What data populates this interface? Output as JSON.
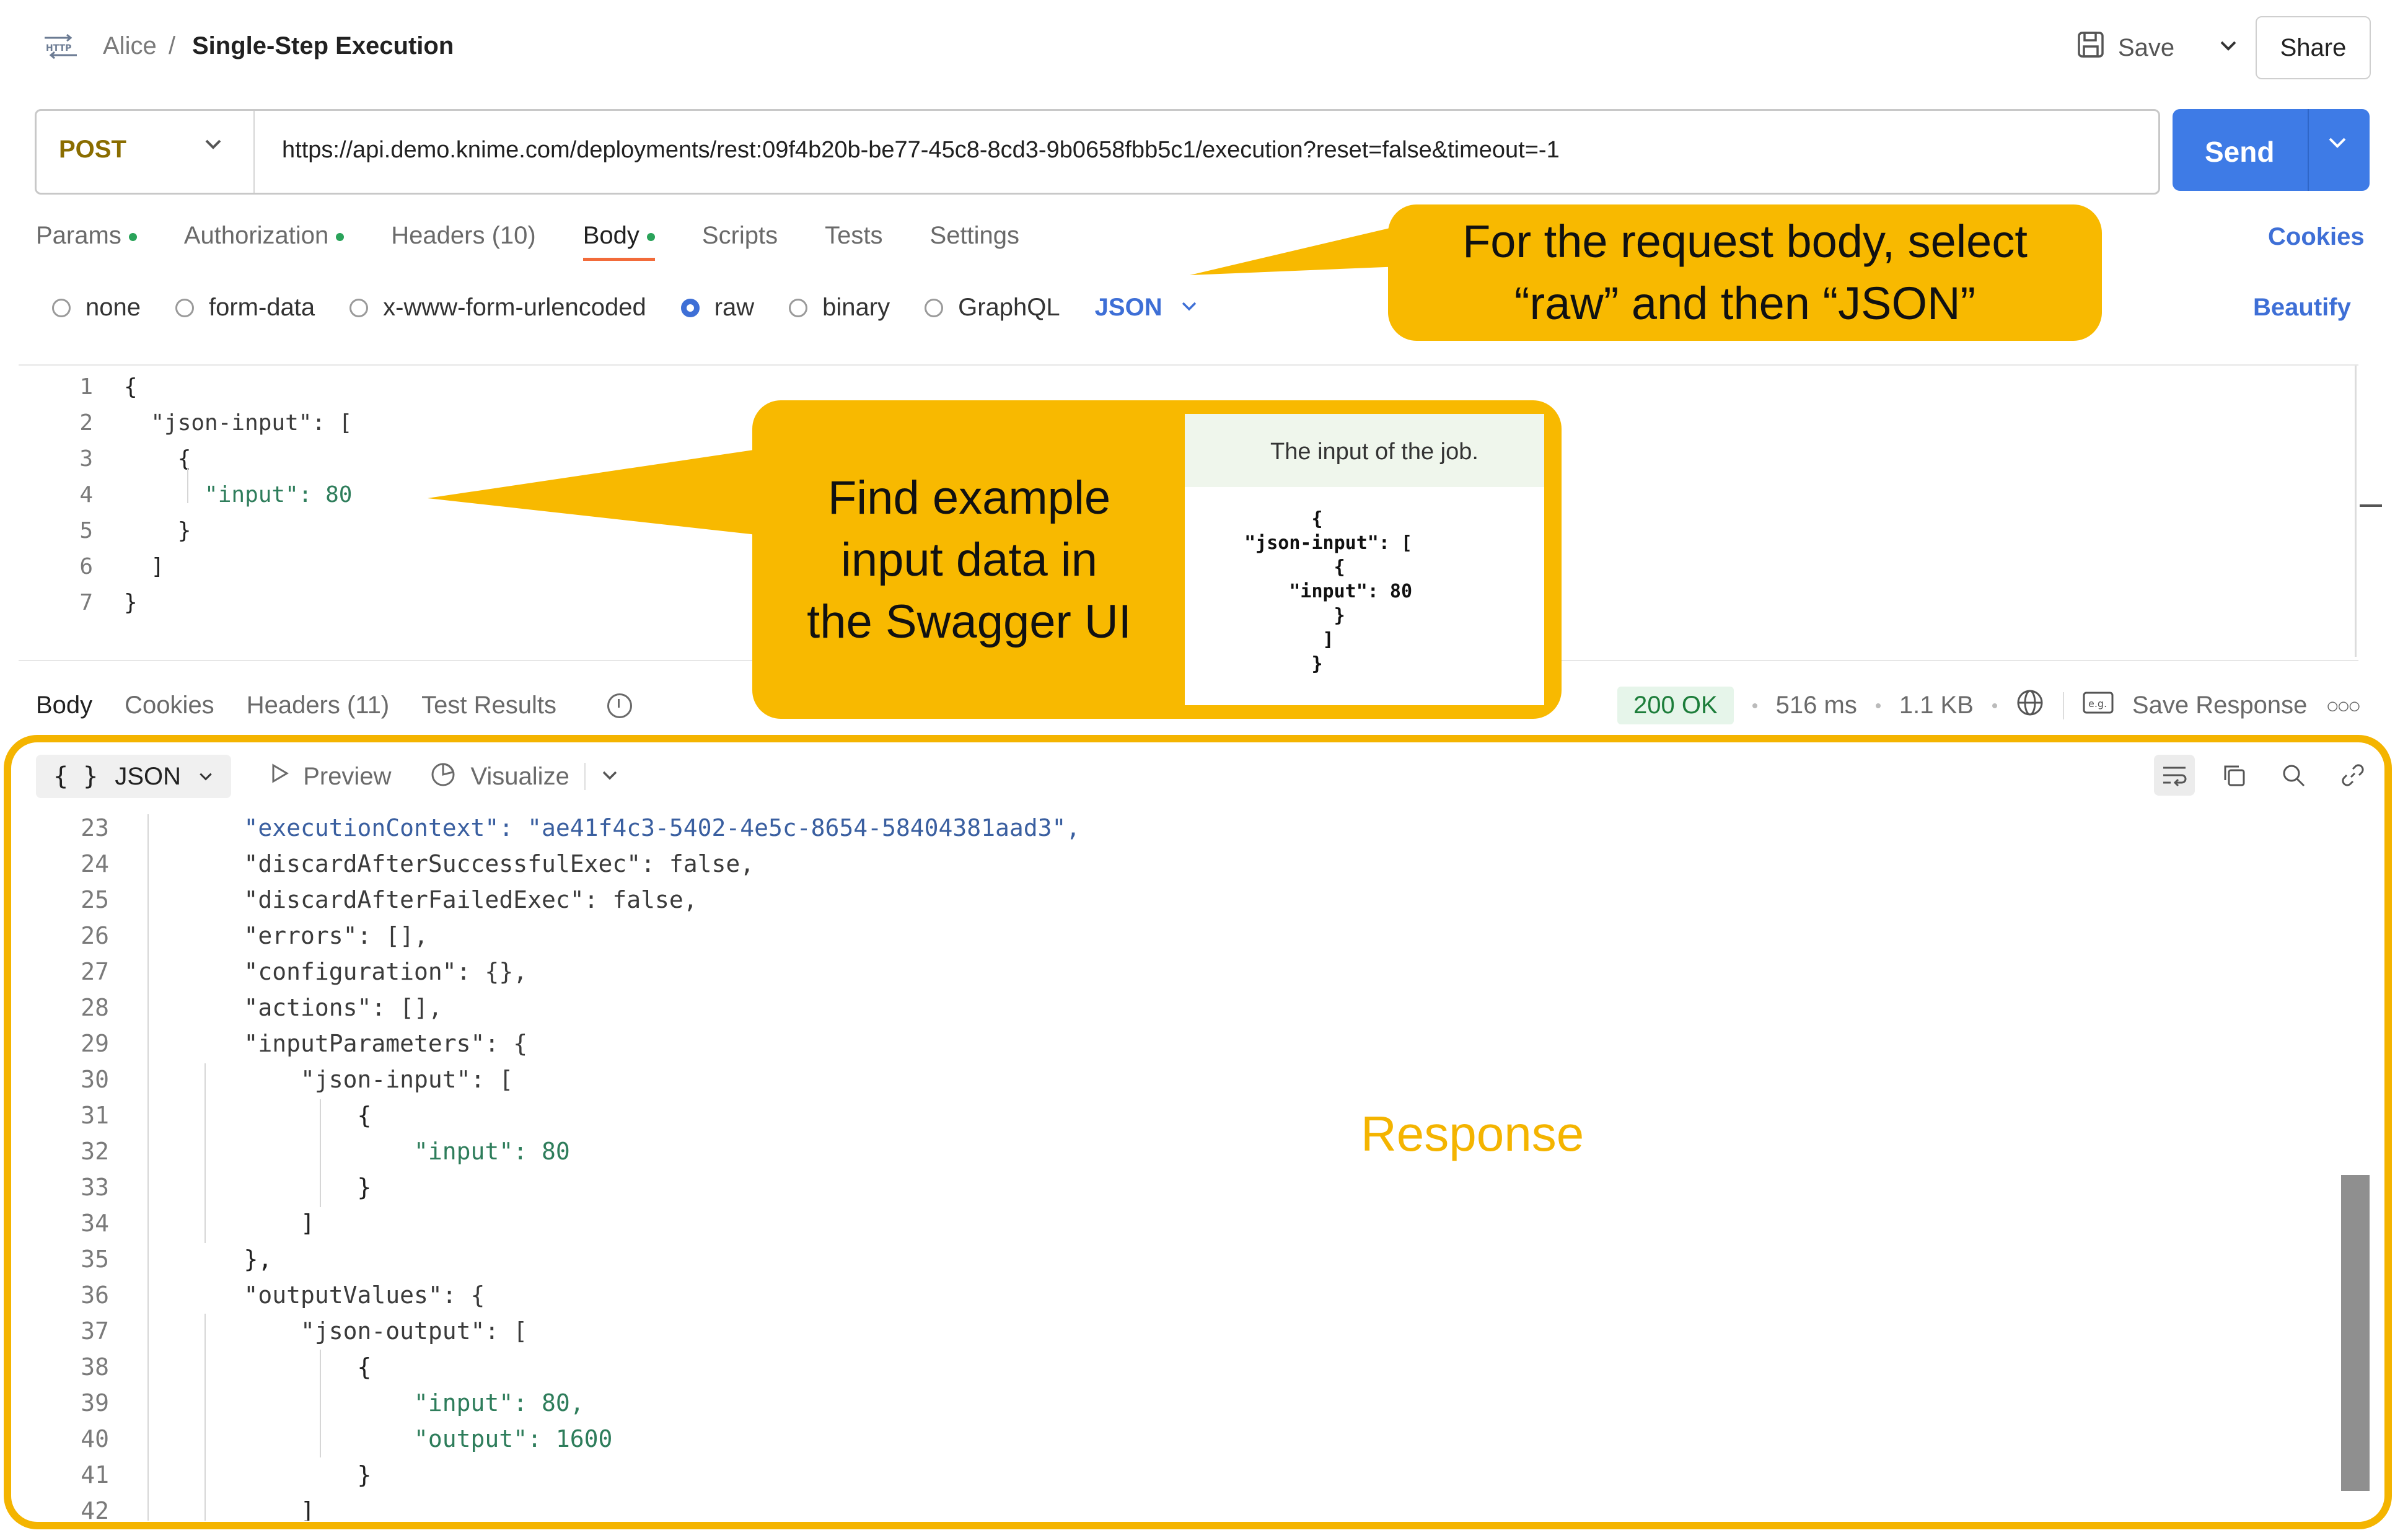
{
  "header": {
    "http_icon": "HTTP",
    "user": "Alice",
    "separator": "/",
    "title": "Single-Step Execution",
    "save_label": "Save",
    "share_label": "Share"
  },
  "request": {
    "method": "POST",
    "url": "https://api.demo.knime.com/deployments/rest:09f4b20b-be77-45c8-8cd3-9b0658fbb5c1/execution?reset=false&timeout=-1",
    "send_label": "Send",
    "tabs": [
      {
        "label": "Params",
        "dot": true
      },
      {
        "label": "Authorization",
        "dot": true
      },
      {
        "label": "Headers (10)",
        "dot": false
      },
      {
        "label": "Body",
        "dot": true,
        "active": true
      },
      {
        "label": "Scripts",
        "dot": false
      },
      {
        "label": "Tests",
        "dot": false
      },
      {
        "label": "Settings",
        "dot": false
      }
    ],
    "cookies_label": "Cookies",
    "body_types": [
      "none",
      "form-data",
      "x-www-form-urlencoded",
      "raw",
      "binary",
      "GraphQL"
    ],
    "selected_body_type": "raw",
    "format": "JSON",
    "beautify_label": "Beautify",
    "body_lines": [
      {
        "n": "1",
        "text": "{"
      },
      {
        "n": "2",
        "text": "  \"json-input\": ["
      },
      {
        "n": "3",
        "text": "    {"
      },
      {
        "n": "4",
        "text": "      \"input\": 80"
      },
      {
        "n": "5",
        "text": "    }"
      },
      {
        "n": "6",
        "text": "  ]"
      },
      {
        "n": "7",
        "text": "}"
      }
    ]
  },
  "response": {
    "tabs": [
      "Body",
      "Cookies",
      "Headers (11)",
      "Test Results"
    ],
    "status": "200 OK",
    "time": "516 ms",
    "size": "1.1 KB",
    "save_response_label": "Save Response",
    "format": "JSON",
    "preview_label": "Preview",
    "visualize_label": "Visualize",
    "lines": [
      {
        "n": "23",
        "text": "    \"executionContext\": \"ae41f4c3-5402-4e5c-8654-58404381aad3\","
      },
      {
        "n": "24",
        "text": "    \"discardAfterSuccessfulExec\": false,"
      },
      {
        "n": "25",
        "text": "    \"discardAfterFailedExec\": false,"
      },
      {
        "n": "26",
        "text": "    \"errors\": [],"
      },
      {
        "n": "27",
        "text": "    \"configuration\": {},"
      },
      {
        "n": "28",
        "text": "    \"actions\": [],"
      },
      {
        "n": "29",
        "text": "    \"inputParameters\": {"
      },
      {
        "n": "30",
        "text": "        \"json-input\": ["
      },
      {
        "n": "31",
        "text": "            {"
      },
      {
        "n": "32",
        "text": "                \"input\": 80"
      },
      {
        "n": "33",
        "text": "            }"
      },
      {
        "n": "34",
        "text": "        ]"
      },
      {
        "n": "35",
        "text": "    },"
      },
      {
        "n": "36",
        "text": "    \"outputValues\": {"
      },
      {
        "n": "37",
        "text": "        \"json-output\": ["
      },
      {
        "n": "38",
        "text": "            {"
      },
      {
        "n": "39",
        "text": "                \"input\": 80,"
      },
      {
        "n": "40",
        "text": "                \"output\": 1600"
      },
      {
        "n": "41",
        "text": "            }"
      },
      {
        "n": "42",
        "text": "        ]"
      }
    ]
  },
  "annotations": {
    "body_callout_line1": "For the request body, select",
    "body_callout_line2": "“raw” and then “JSON”",
    "swagger_callout_line1": "Find example",
    "swagger_callout_line2": "input data in",
    "swagger_callout_line3": "the Swagger UI",
    "swagger_desc": "The input of the job.",
    "swagger_code": "{\n  \"json-input\": [\n    {\n      \"input\": 80\n    }\n  ]\n}",
    "response_label": "Response"
  },
  "colors": {
    "accent": "#3e7be6",
    "highlight": "#f8b900",
    "status_ok": "#1c7d3a",
    "active_tab": "#f26b3a"
  }
}
